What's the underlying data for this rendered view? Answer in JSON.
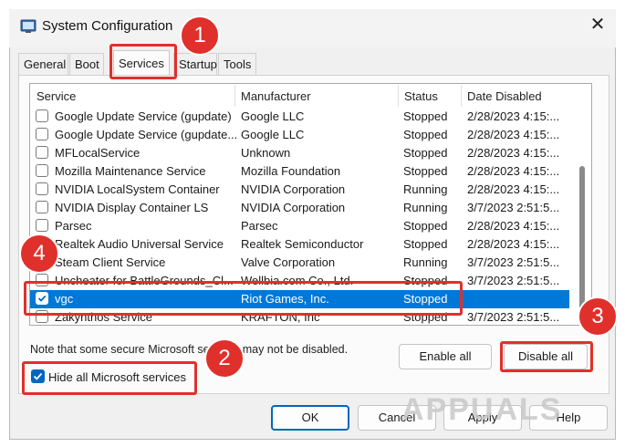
{
  "window": {
    "title": "System Configuration",
    "close_glyph": "✕"
  },
  "tabs": [
    {
      "label": "General"
    },
    {
      "label": "Boot"
    },
    {
      "label": "Services"
    },
    {
      "label": "Startup"
    },
    {
      "label": "Tools"
    }
  ],
  "table": {
    "columns": [
      "Service",
      "Manufacturer",
      "Status",
      "Date Disabled"
    ],
    "rows": [
      {
        "service": "Google Update Service (gupdate)",
        "manufacturer": "Google LLC",
        "status": "Stopped",
        "date": "2/28/2023 4:15:...",
        "checked": false,
        "selected": false
      },
      {
        "service": "Google Update Service (gupdate...",
        "manufacturer": "Google LLC",
        "status": "Stopped",
        "date": "2/28/2023 4:15:...",
        "checked": false,
        "selected": false
      },
      {
        "service": "MFLocalService",
        "manufacturer": "Unknown",
        "status": "Stopped",
        "date": "2/28/2023 4:15:...",
        "checked": false,
        "selected": false
      },
      {
        "service": "Mozilla Maintenance Service",
        "manufacturer": "Mozilla Foundation",
        "status": "Stopped",
        "date": "2/28/2023 4:15:...",
        "checked": false,
        "selected": false
      },
      {
        "service": "NVIDIA LocalSystem Container",
        "manufacturer": "NVIDIA Corporation",
        "status": "Running",
        "date": "2/28/2023 4:15:...",
        "checked": false,
        "selected": false
      },
      {
        "service": "NVIDIA Display Container LS",
        "manufacturer": "NVIDIA Corporation",
        "status": "Running",
        "date": "3/7/2023 2:51:5...",
        "checked": false,
        "selected": false
      },
      {
        "service": "Parsec",
        "manufacturer": "Parsec",
        "status": "Stopped",
        "date": "2/28/2023 4:15:...",
        "checked": false,
        "selected": false
      },
      {
        "service": "Realtek Audio Universal Service",
        "manufacturer": "Realtek Semiconductor",
        "status": "Stopped",
        "date": "2/28/2023 4:15:...",
        "checked": false,
        "selected": false
      },
      {
        "service": "Steam Client Service",
        "manufacturer": "Valve Corporation",
        "status": "Running",
        "date": "3/7/2023 2:51:5...",
        "checked": false,
        "selected": false
      },
      {
        "service": "Uncheater for BattleGrounds_Cl...",
        "manufacturer": "Wellbia.com Co., Ltd.",
        "status": "Stopped",
        "date": "3/7/2023 2:51:5...",
        "checked": false,
        "selected": false
      },
      {
        "service": "vgc",
        "manufacturer": "Riot Games, Inc.",
        "status": "Stopped",
        "date": "",
        "checked": true,
        "selected": true
      },
      {
        "service": "Zakynthos Service",
        "manufacturer": "KRAFTON, Inc",
        "status": "Stopped",
        "date": "3/7/2023 2:51:5...",
        "checked": false,
        "selected": false
      }
    ]
  },
  "note": "Note that some secure Microsoft services may not be disabled.",
  "buttons": {
    "enable_all": "Enable all",
    "disable_all": "Disable all",
    "ok": "OK",
    "cancel": "Cancel",
    "apply": "Apply",
    "help": "Help"
  },
  "hide_ms": {
    "label": "Hide all Microsoft services",
    "checked": true
  },
  "annotations": {
    "badge1": "1",
    "badge2": "2",
    "badge3": "3",
    "badge4": "4",
    "color": "#e0302c"
  },
  "watermark": "APPUALS",
  "colors": {
    "selection": "#0078d7",
    "accent": "#0067c0"
  }
}
